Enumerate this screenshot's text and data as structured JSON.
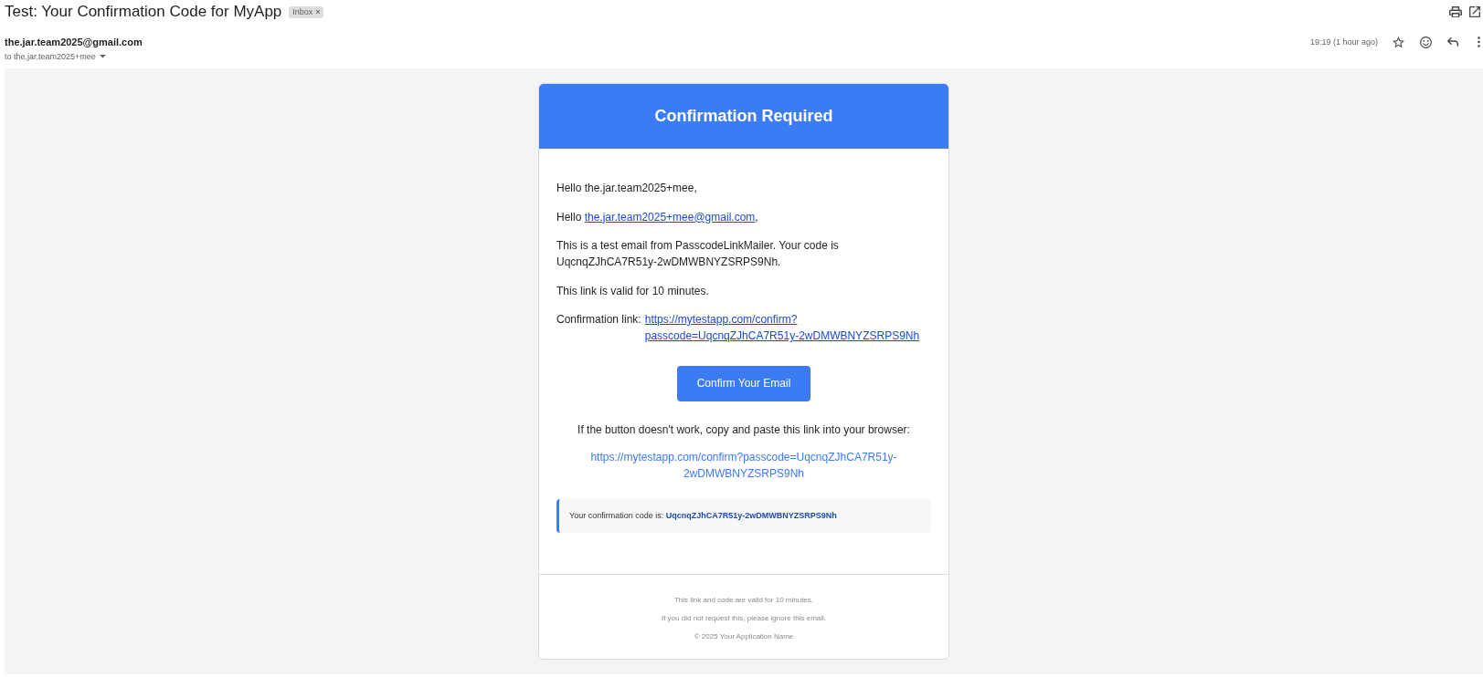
{
  "message": {
    "subject": "Test: Your Confirmation Code for MyApp",
    "label": "Inbox",
    "label_remove": "×"
  },
  "sender": {
    "address": "the.jar.team2025@gmail.com",
    "recipients": "to the.jar.team2025+mee",
    "time": "19:19 (1 hour ago)",
    "starred": false
  },
  "email": {
    "header_title": "Confirmation Required",
    "paragraphs": [
      {
        "kind": "plain",
        "text": "Hello the.jar.team2025+mee,"
      },
      {
        "kind": "inline_link",
        "text": "Hello ",
        "link": "the.jar.team2025+mee@gmail.com",
        "after": ","
      },
      {
        "kind": "plain",
        "text": "This is a test email from PasscodeLinkMailer. Your code is UqcnqZJhCA7R51y-2wDMWBNYZSRPS9Nh."
      },
      {
        "kind": "plain",
        "text": "This link is valid for 10 minutes."
      },
      {
        "kind": "labeled_link",
        "text": "Confirmation link:",
        "link": "https://mytestapp.com/confirm?passcode=UqcnqZJhCA7R51y-2wDMWBNYZSRPS9Nh"
      }
    ],
    "button": "Confirm Your Email",
    "fallback_text": "If the button doesn't work, copy and paste this link into your browser:",
    "fallback_link": "https://mytestapp.com/confirm?passcode=UqcnqZJhCA7R51y-2wDMWBNYZSRPS9Nh",
    "code_note": "Your confirmation code is: **UqcnqZJhCA7R51y-2wDMWBNYZSRPS9Nh**",
    "footer": [
      "This link and code are valid for 10 minutes.",
      "If you did not request this, please ignore this email.",
      "© 2025 Your Application Name"
    ]
  }
}
